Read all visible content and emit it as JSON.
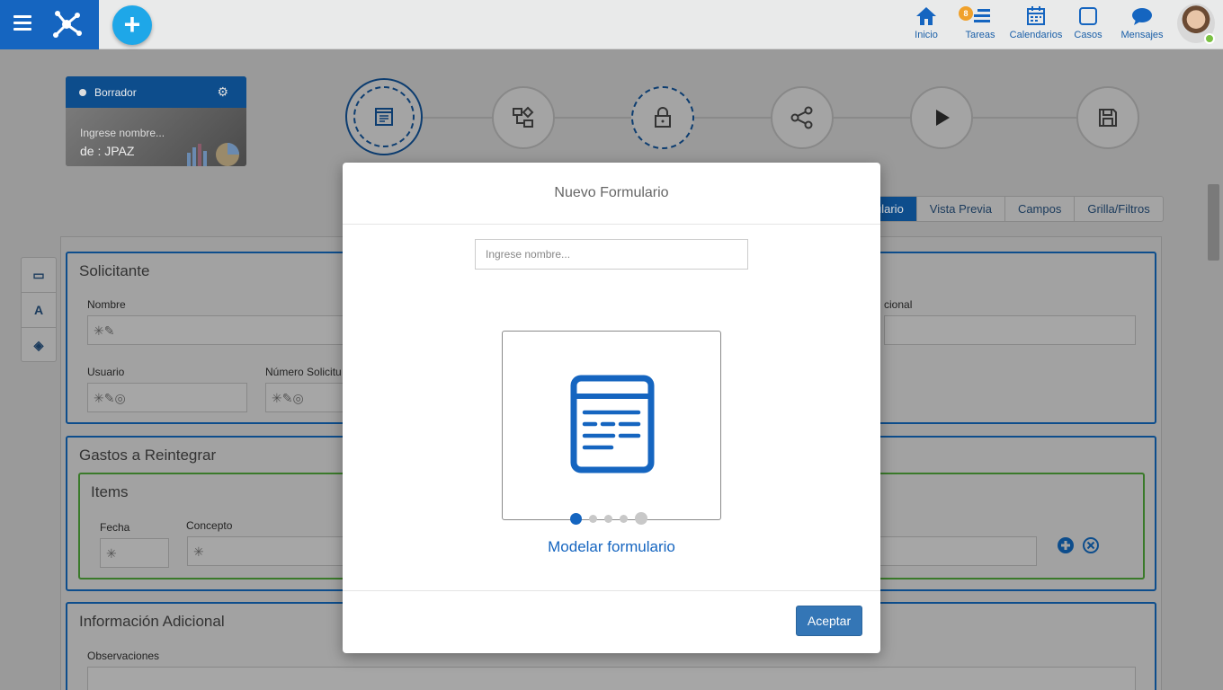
{
  "topbar": {
    "nav": [
      {
        "label": "Inicio",
        "icon": "home-icon"
      },
      {
        "label": "Tareas",
        "icon": "tasks-icon",
        "badge": "8"
      },
      {
        "label": "Calendarios",
        "icon": "calendar-icon"
      },
      {
        "label": "Casos",
        "icon": "case-icon"
      },
      {
        "label": "Mensajes",
        "icon": "message-icon"
      }
    ],
    "add_button": "+"
  },
  "draft": {
    "status": "Borrador",
    "name": "Ingrese nombre...",
    "by": "de : JPAZ"
  },
  "tabs": [
    "ulario",
    "Vista Previa",
    "Campos",
    "Grilla/Filtros"
  ],
  "sections": {
    "solicitante": {
      "title": "Solicitante",
      "nombre_label": "Nombre",
      "adicional_label": "cional",
      "usuario_label": "Usuario",
      "numero_label": "Número Solicitu",
      "nombre_value": "✳✎",
      "usuario_value": "✳✎◎",
      "numero_value": "✳✎◎"
    },
    "gastos": {
      "title": "Gastos a Reintegrar",
      "grid_title": "Items",
      "fecha_label": "Fecha",
      "concepto_label": "Concepto",
      "fecha_value": "✳",
      "concepto_value": "✳"
    },
    "info": {
      "title": "Información Adicional",
      "observaciones_label": "Observaciones"
    }
  },
  "modal": {
    "title": "Nuevo Formulario",
    "input_placeholder": "Ingrese nombre...",
    "caption": "Modelar formulario",
    "accept": "Aceptar",
    "carousel_index": 1,
    "carousel_count": 5
  },
  "colors": {
    "brand": "#1565c0",
    "accent": "#1ea7e8",
    "button": "#3476b6"
  }
}
